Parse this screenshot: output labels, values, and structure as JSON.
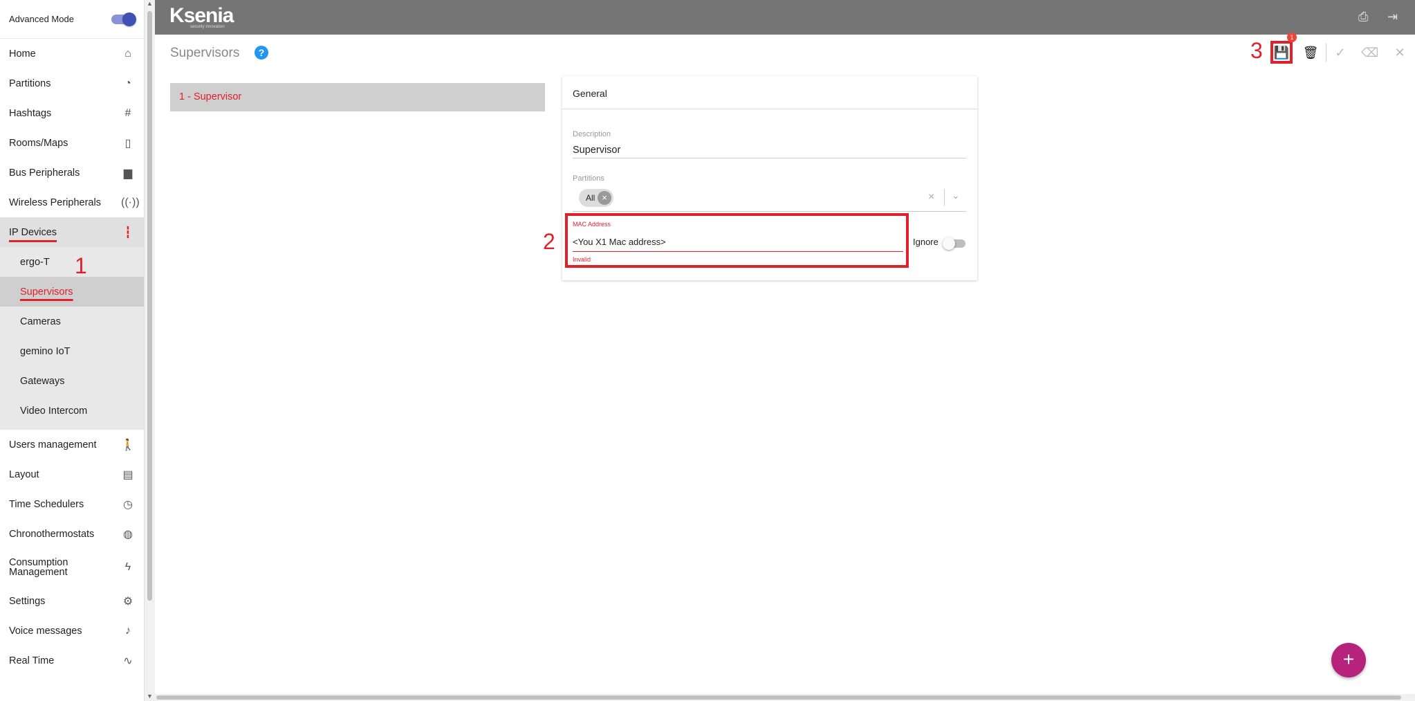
{
  "sidebar": {
    "advanced_mode_label": "Advanced Mode",
    "items": [
      {
        "label": "Home",
        "icon": "home-icon",
        "glyph": "⌂"
      },
      {
        "label": "Partitions",
        "icon": "pie-chart-icon",
        "glyph": "◔"
      },
      {
        "label": "Hashtags",
        "icon": "hashtag-icon",
        "glyph": "#"
      },
      {
        "label": "Rooms/Maps",
        "icon": "door-icon",
        "glyph": "▯"
      },
      {
        "label": "Bus Peripherals",
        "icon": "peripheral-icon",
        "glyph": "▆"
      },
      {
        "label": "Wireless Peripherals",
        "icon": "antenna-icon",
        "glyph": "((·))"
      },
      {
        "label": "IP Devices",
        "icon": "ip-device-icon",
        "glyph": "┇"
      }
    ],
    "sub_items": [
      "ergo-T",
      "Supervisors",
      "Cameras",
      "gemino IoT",
      "Gateways",
      "Video Intercom"
    ],
    "items_after": [
      {
        "label": "Users management",
        "icon": "walking-person-icon",
        "glyph": "🚶"
      },
      {
        "label": "Layout",
        "icon": "briefcase-icon",
        "glyph": "▤"
      },
      {
        "label": "Time Schedulers",
        "icon": "clock-icon",
        "glyph": "◷"
      },
      {
        "label": "Chronothermostats",
        "icon": "thermostat-icon",
        "glyph": "◍"
      },
      {
        "label": "Consumption Management",
        "icon": "lightning-icon",
        "glyph": "ϟ"
      },
      {
        "label": "Settings",
        "icon": "gear-icon",
        "glyph": "⚙"
      },
      {
        "label": "Voice messages",
        "icon": "voice-icon",
        "glyph": "♪"
      },
      {
        "label": "Real Time",
        "icon": "pulse-icon",
        "glyph": "∿"
      }
    ]
  },
  "header": {
    "logo_text": "Ksenia",
    "logo_tagline": "security innovation"
  },
  "page": {
    "title": "Supervisors",
    "list": [
      "1 - Supervisor"
    ]
  },
  "card": {
    "title": "General",
    "description_label": "Description",
    "description_value": "Supervisor",
    "partitions_label": "Partitions",
    "partitions_chip": "All",
    "mac_label": "MAC Address",
    "mac_value": "<You X1 Mac address>",
    "mac_error": "Invalid",
    "ignore_label": "Ignore"
  },
  "toolbar": {
    "save_badge": "1"
  },
  "annotations": [
    "1",
    "2",
    "3"
  ],
  "colors": {
    "accent_red": "#e0202b",
    "topbar": "#757575",
    "fab": "#b5237c",
    "help_blue": "#2196f3"
  }
}
